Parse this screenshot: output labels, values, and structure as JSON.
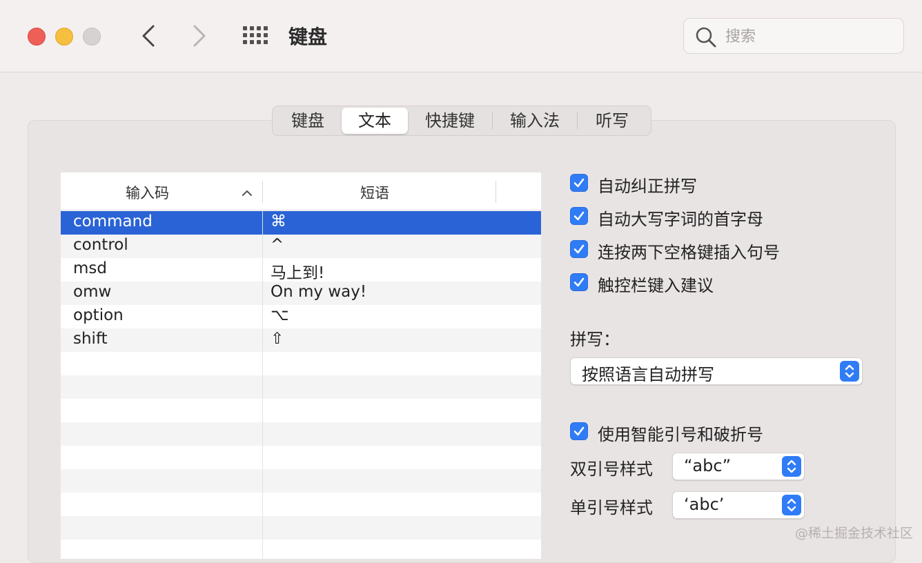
{
  "window": {
    "title": "键盘",
    "search_placeholder": "搜索",
    "traffic_lights": [
      "close",
      "minimize",
      "zoom"
    ],
    "icons": {
      "back": "chevron-left-icon",
      "forward": "chevron-right-icon",
      "grid": "grid-icon",
      "search": "magnifier-icon"
    }
  },
  "tabs": [
    {
      "label": "键盘",
      "active": false
    },
    {
      "label": "文本",
      "active": true
    },
    {
      "label": "快捷键",
      "active": false
    },
    {
      "label": "输入法",
      "active": false
    },
    {
      "label": "听写",
      "active": false
    }
  ],
  "table": {
    "col1_header": "输入码",
    "col2_header": "短语",
    "rows": [
      {
        "key": "command",
        "value": "⌘",
        "selected": true
      },
      {
        "key": "control",
        "value": "^",
        "selected": false
      },
      {
        "key": "msd",
        "value": "马上到!",
        "selected": false
      },
      {
        "key": "omw",
        "value": "On my way!",
        "selected": false
      },
      {
        "key": "option",
        "value": "⌥",
        "selected": false
      },
      {
        "key": "shift",
        "value": "⇧",
        "selected": false
      }
    ]
  },
  "options": {
    "autocorrect": {
      "label": "自动纠正拼写",
      "checked": true
    },
    "autocap": {
      "label": "自动大写字词的首字母",
      "checked": true
    },
    "double_space": {
      "label": "连按两下空格键插入句号",
      "checked": true
    },
    "touchbar": {
      "label": "触控栏键入建议",
      "checked": true
    },
    "spelling_label": "拼写：",
    "spelling_value": "按照语言自动拼写",
    "smart_quotes": {
      "label": "使用智能引号和破折号",
      "checked": true
    },
    "double_quote_label": "双引号样式",
    "double_quote_value": "“abc”",
    "single_quote_label": "单引号样式",
    "single_quote_value": "‘abc’"
  },
  "watermark": "@稀土掘金技术社区",
  "colors": {
    "accent": "#2f7cf6",
    "selection": "#2a63d6"
  }
}
